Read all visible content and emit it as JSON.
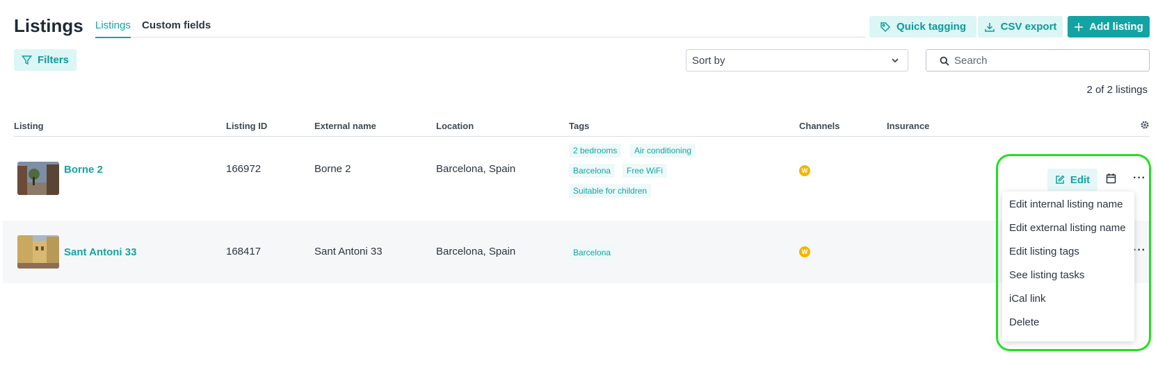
{
  "page": {
    "title": "Listings"
  },
  "tabs": [
    {
      "label": "Listings",
      "active": true
    },
    {
      "label": "Custom fields",
      "active": false
    }
  ],
  "toolbar": {
    "quick_tagging": "Quick tagging",
    "csv_export": "CSV export",
    "add_listing": "Add listing",
    "filters": "Filters",
    "sort_by": "Sort by",
    "search_placeholder": "Search"
  },
  "listing_count": "2 of 2 listings",
  "table": {
    "columns": [
      "Listing",
      "Listing ID",
      "External name",
      "Location",
      "Tags",
      "Channels",
      "Insurance"
    ],
    "rows": [
      {
        "name": "Borne 2",
        "listing_id": "166972",
        "external_name": "Borne 2",
        "location": "Barcelona, Spain",
        "tags": [
          "2 bedrooms",
          "Air conditioning",
          "Barcelona",
          "Free WiFi",
          "Suitable for children"
        ],
        "channel_icon": "W",
        "insurance": ""
      },
      {
        "name": "Sant Antoni 33",
        "listing_id": "168417",
        "external_name": "Sant Antoni 33",
        "location": "Barcelona, Spain",
        "tags": [
          "Barcelona"
        ],
        "channel_icon": "W",
        "insurance": ""
      }
    ]
  },
  "row_actions": {
    "edit_label": "Edit",
    "more_label": "···",
    "menu_items": [
      "Edit internal listing name",
      "Edit external listing name",
      "Edit listing tags",
      "See listing tasks",
      "iCal link",
      "Delete"
    ]
  },
  "colors": {
    "accent": "#14a3a3",
    "accent_soft": "#dcf5f5",
    "channel_badge": "#f2b600",
    "highlight": "#21e021"
  },
  "icons": [
    "tag-icon",
    "download-icon",
    "plus-icon",
    "filter-icon",
    "chevron-down-icon",
    "search-icon",
    "gear-icon",
    "edit-icon",
    "calendar-icon",
    "more-icon"
  ]
}
